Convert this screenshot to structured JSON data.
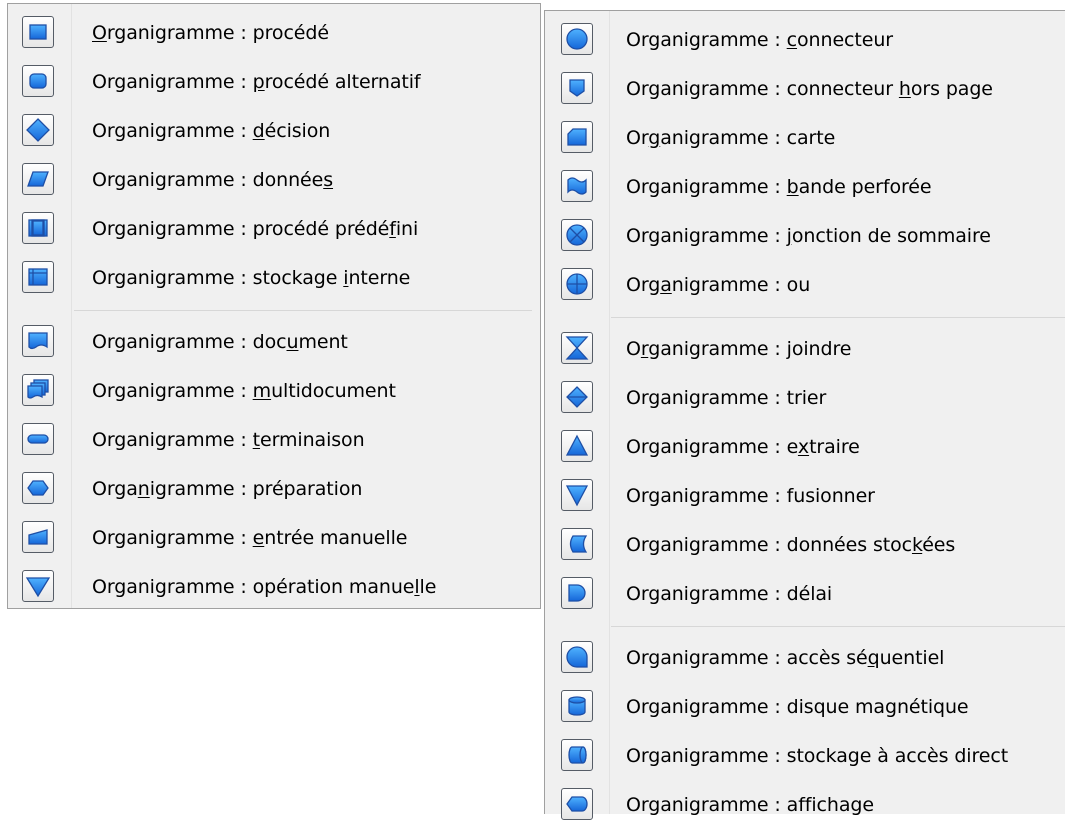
{
  "menus": [
    {
      "id": "left",
      "groups": [
        [
          {
            "prefix": "",
            "key": "O",
            "suffix": "rganigramme : procédé",
            "icon": "process-icon"
          },
          {
            "prefix": "Organigramme : ",
            "key": "p",
            "suffix": "rocédé alternatif",
            "icon": "alternate-process-icon"
          },
          {
            "prefix": "Organigramme : ",
            "key": "d",
            "suffix": "écision",
            "icon": "decision-icon"
          },
          {
            "prefix": "Organigramme : donnée",
            "key": "s",
            "suffix": "",
            "icon": "data-icon"
          },
          {
            "prefix": "Organigramme : procédé prédé",
            "key": "f",
            "suffix": "ini",
            "icon": "predefined-process-icon"
          },
          {
            "prefix": "Organigramme : stockage ",
            "key": "i",
            "suffix": "nterne",
            "icon": "internal-storage-icon"
          }
        ],
        [
          {
            "prefix": "Organigramme : doc",
            "key": "u",
            "suffix": "ment",
            "icon": "document-icon"
          },
          {
            "prefix": "Organigramme : ",
            "key": "m",
            "suffix": "ultidocument",
            "icon": "multidocument-icon"
          },
          {
            "prefix": "Organigramme : ",
            "key": "t",
            "suffix": "erminaison",
            "icon": "terminator-icon"
          },
          {
            "prefix": "Orga",
            "key": "n",
            "suffix": "igramme : préparation",
            "icon": "preparation-icon"
          },
          {
            "prefix": "Organigramme : ",
            "key": "e",
            "suffix": "ntrée manuelle",
            "icon": "manual-input-icon"
          },
          {
            "prefix": "Organigramme : opération manue",
            "key": "l",
            "suffix": "le",
            "icon": "manual-operation-icon"
          }
        ]
      ]
    },
    {
      "id": "right",
      "groups": [
        [
          {
            "prefix": "Organigramme : ",
            "key": "c",
            "suffix": "onnecteur",
            "icon": "connector-icon"
          },
          {
            "prefix": "Organigramme : connecteur ",
            "key": "h",
            "suffix": "ors page",
            "icon": "off-page-connector-icon"
          },
          {
            "prefix": "Or",
            "key": "g",
            "suffix": "anigramme : carte",
            "icon": "card-icon"
          },
          {
            "prefix": "Organigramme : ",
            "key": "b",
            "suffix": "ande perforée",
            "icon": "punched-tape-icon"
          },
          {
            "prefix": "Organigramme : ",
            "key": "j",
            "suffix": "onction de sommaire",
            "icon": "summing-junction-icon"
          },
          {
            "prefix": "Org",
            "key": "a",
            "suffix": "nigramme : ou",
            "icon": "or-icon"
          }
        ],
        [
          {
            "prefix": "O",
            "key": "r",
            "suffix": "ganigramme : joindre",
            "icon": "collate-icon"
          },
          {
            "prefix": "Organigramme : trier",
            "key": "",
            "suffix": "",
            "icon": "sort-icon"
          },
          {
            "prefix": "Organigramme : e",
            "key": "x",
            "suffix": "traire",
            "icon": "extract-icon"
          },
          {
            "prefix": "Organigramme : fusionner",
            "key": "",
            "suffix": "",
            "icon": "merge-icon"
          },
          {
            "prefix": "Organigramme : données stoc",
            "key": "k",
            "suffix": "ées",
            "icon": "stored-data-icon"
          },
          {
            "prefix": "Organigramme : délai",
            "key": "",
            "suffix": "",
            "icon": "delay-icon"
          }
        ],
        [
          {
            "prefix": "Organigramme : accès sé",
            "key": "q",
            "suffix": "uentiel",
            "icon": "sequential-access-icon"
          },
          {
            "prefix": "Organigramme : disque magnétique",
            "key": "",
            "suffix": "",
            "icon": "magnetic-disk-icon"
          },
          {
            "prefix": "Organigramme : stockage à accès direct",
            "key": "",
            "suffix": "",
            "icon": "direct-access-storage-icon"
          },
          {
            "prefix": "Organigramme : affichage",
            "key": "",
            "suffix": "",
            "icon": "display-icon"
          }
        ]
      ]
    }
  ]
}
